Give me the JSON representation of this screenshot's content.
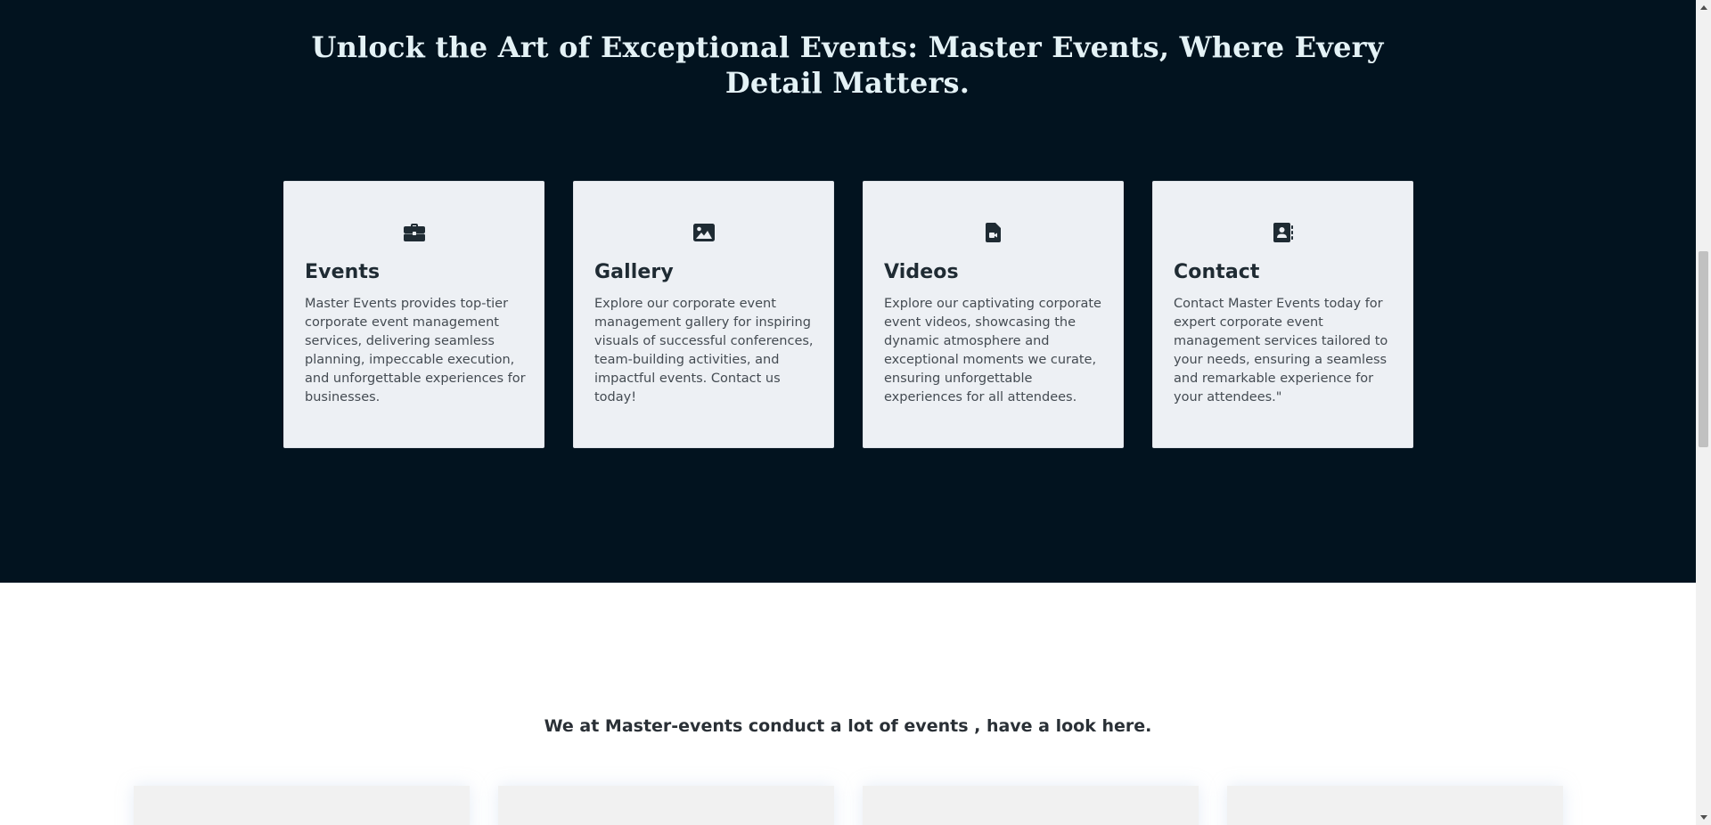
{
  "hero": {
    "title": "Unlock the Art of Exceptional Events: Master Events, Where Every Detail Matters."
  },
  "cards": [
    {
      "icon": "briefcase-icon",
      "title": "Events",
      "text": "Master Events provides top-tier corporate event management services, delivering seamless planning, impeccable execution, and unforgettable experiences for businesses."
    },
    {
      "icon": "image-icon",
      "title": "Gallery",
      "text": "Explore our corporate event management gallery for inspiring visuals of successful conferences, team-building activities, and impactful events. Contact us today!"
    },
    {
      "icon": "video-file-icon",
      "title": "Videos",
      "text": "Explore our captivating corporate event videos, showcasing the dynamic atmosphere and exceptional moments we curate, ensuring unforgettable experiences for all attendees."
    },
    {
      "icon": "address-book-icon",
      "title": "Contact",
      "text": "Contact Master Events today for expert corporate event management services tailored to your needs, ensuring a seamless and remarkable experience for your attendees.\""
    }
  ],
  "events_section": {
    "heading": "We at Master-events conduct a lot of events , have a look here."
  },
  "colors": {
    "hero_bg": "#02131f",
    "hero_title": "#e4f2f6",
    "card_bg": "#edf0f4",
    "icon": "#1f2b33"
  }
}
